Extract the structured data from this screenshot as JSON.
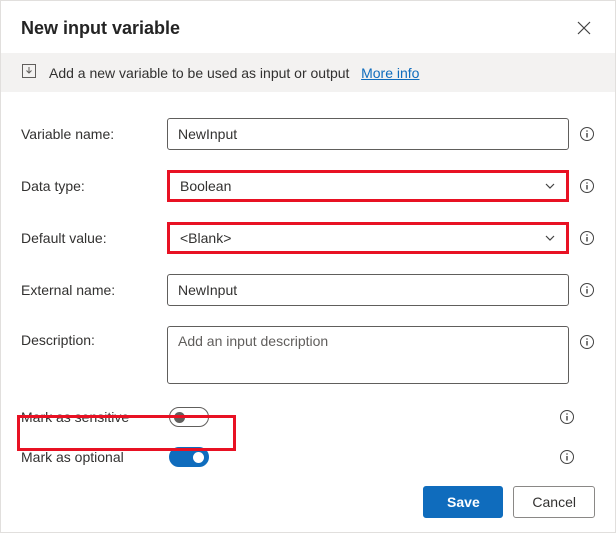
{
  "dialog": {
    "title": "New input variable"
  },
  "banner": {
    "text": "Add a new variable to be used as input or output",
    "link": "More info"
  },
  "fields": {
    "variable_name": {
      "label": "Variable name:",
      "value": "NewInput"
    },
    "data_type": {
      "label": "Data type:",
      "value": "Boolean"
    },
    "default_value": {
      "label": "Default value:",
      "value": "<Blank>"
    },
    "external_name": {
      "label": "External name:",
      "value": "NewInput"
    },
    "description": {
      "label": "Description:",
      "placeholder": "Add an input description"
    }
  },
  "toggles": {
    "sensitive": {
      "label": "Mark as sensitive",
      "on": false
    },
    "optional": {
      "label": "Mark as optional",
      "on": true
    }
  },
  "footer": {
    "save": "Save",
    "cancel": "Cancel"
  }
}
